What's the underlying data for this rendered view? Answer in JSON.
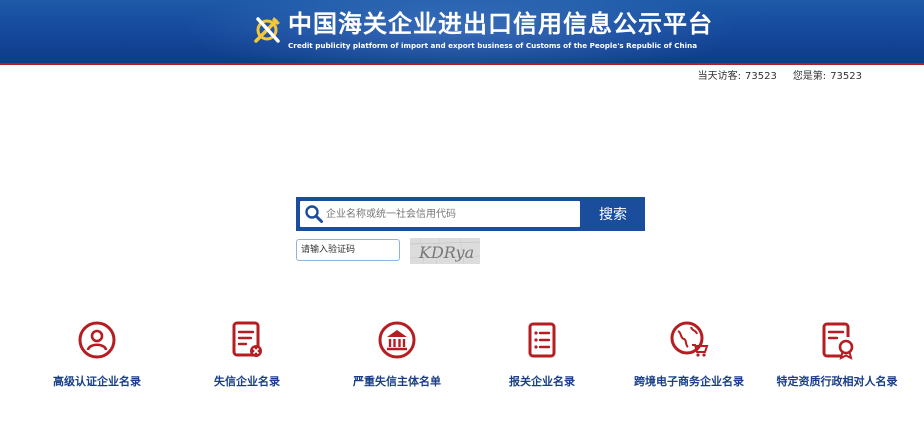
{
  "header": {
    "title": "中国海关企业进出口信用信息公示平台",
    "subtitle": "Credit publicity platform of import and export business of Customs of the People's Republic of China"
  },
  "visits": {
    "today_label": "当天访客:",
    "today_count": "73523",
    "total_label": "您是第:",
    "total_count": "73523"
  },
  "search": {
    "placeholder": "企业名称或统一社会信用代码",
    "button_label": "搜索",
    "captcha_placeholder": "请输入验证码",
    "captcha_text": "KDRya"
  },
  "functions": [
    {
      "label": "高级认证企业名录",
      "icon": "person-icon"
    },
    {
      "label": "失信企业名录",
      "icon": "document-x-icon"
    },
    {
      "label": "严重失信主体名单",
      "icon": "bank-icon"
    },
    {
      "label": "报关企业名录",
      "icon": "list-icon"
    },
    {
      "label": "跨境电子商务企业名录",
      "icon": "globe-cart-icon"
    },
    {
      "label": "特定资质行政相对人名录",
      "icon": "certificate-icon"
    }
  ],
  "colors": {
    "header": "#14479a",
    "accent_red": "#b61d22",
    "label_blue": "#1a3f86",
    "search_blue": "#1a4d9c"
  }
}
